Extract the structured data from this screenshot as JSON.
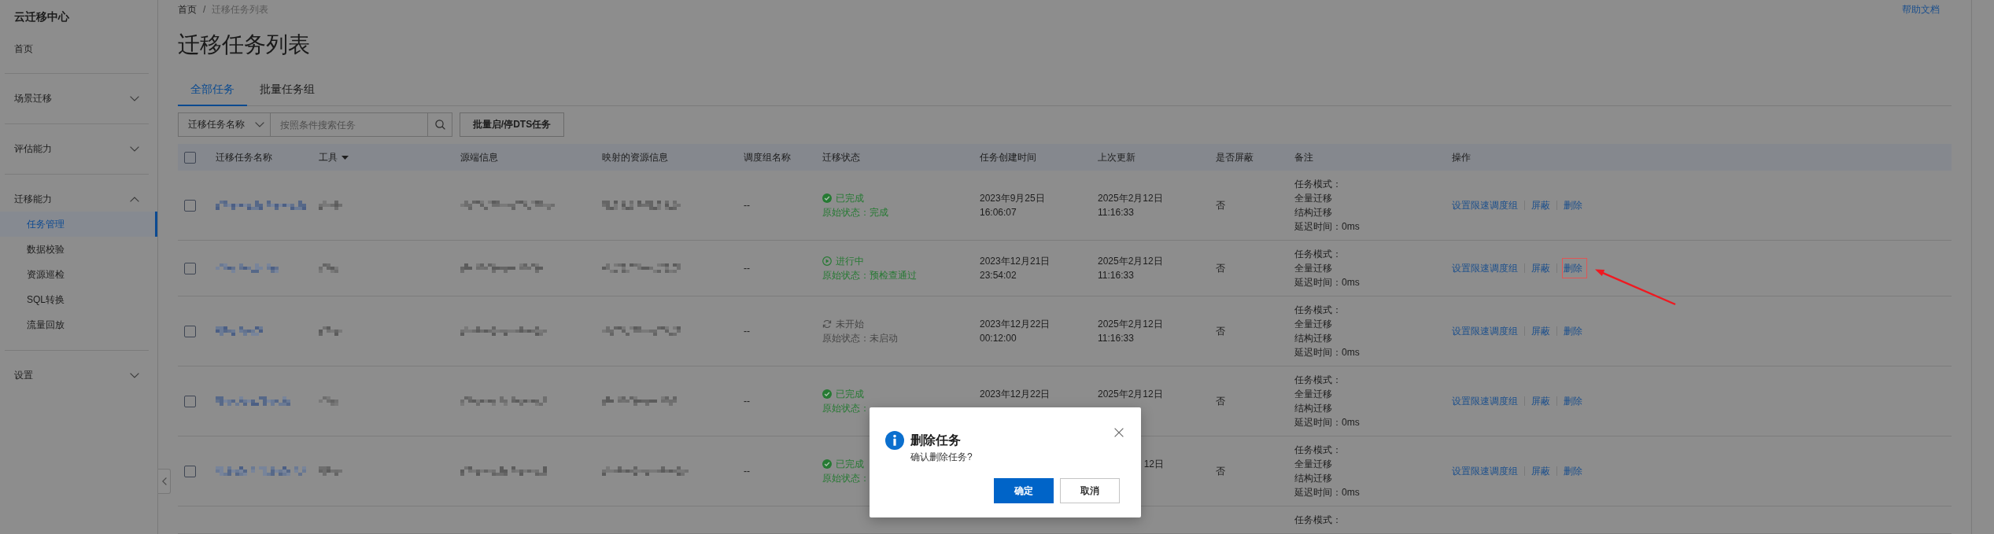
{
  "sidebar": {
    "title": "云迁移中心",
    "home": {
      "label": "首页",
      "selected": false
    },
    "groups": [
      {
        "label": "场景迁移",
        "expanded": false
      },
      {
        "label": "评估能力",
        "expanded": false
      },
      {
        "label": "迁移能力",
        "expanded": true,
        "children": [
          {
            "label": "任务管理",
            "selected": true
          },
          {
            "label": "数据校验",
            "selected": false
          },
          {
            "label": "资源巡检",
            "selected": false
          },
          {
            "label": "SQL转换",
            "selected": false
          },
          {
            "label": "流量回放",
            "selected": false
          }
        ]
      },
      {
        "label": "设置",
        "expanded": false
      }
    ]
  },
  "breadcrumb": {
    "items": [
      "首页",
      "迁移任务列表"
    ],
    "separator": "/"
  },
  "help_link": "帮助文档",
  "title": "迁移任务列表",
  "tabs": [
    {
      "label": "全部任务",
      "selected": true
    },
    {
      "label": "批量任务组",
      "selected": false
    }
  ],
  "toolbar": {
    "field_select": "迁移任务名称",
    "search": {
      "placeholder": "按照条件搜索任务"
    },
    "batch_button": "批量启/停DTS任务"
  },
  "table": {
    "select_all": {
      "checked": false
    },
    "columns": [
      {
        "label": "迁移任务名称"
      },
      {
        "label": "工具",
        "filter": true
      },
      {
        "label": "源端信息"
      },
      {
        "label": "映射的资源信息"
      },
      {
        "label": "调度组名称"
      },
      {
        "label": "迁移状态"
      },
      {
        "label": "任务创建时间"
      },
      {
        "label": "上次更新"
      },
      {
        "label": "是否屏蔽"
      },
      {
        "label": "备注"
      },
      {
        "label": "操作"
      }
    ],
    "rows": [
      {
        "checked": false,
        "pixelated": true,
        "dispatch_group": "--",
        "status": {
          "kind": "done",
          "label": "已完成",
          "original": "原始状态：完成"
        },
        "created": {
          "lines": [
            "2023年9月25日",
            "16:06:07"
          ]
        },
        "updated": {
          "lines": [
            "2025年2月12日",
            "11:16:33"
          ]
        },
        "masked": "否",
        "note": [
          "任务模式：",
          "全量迁移",
          "结构迁移",
          "延迟时间：0ms"
        ],
        "actions": [
          {
            "label": "设置限速调度组",
            "highlighted": false
          },
          {
            "label": "屏蔽",
            "highlighted": false
          },
          {
            "label": "删除",
            "highlighted": false
          }
        ]
      },
      {
        "checked": false,
        "pixelated": true,
        "dispatch_group": "--",
        "status": {
          "kind": "running",
          "label": "进行中",
          "original": "原始状态：预检查通过"
        },
        "created": {
          "lines": [
            "2023年12月21日",
            "23:54:02"
          ]
        },
        "updated": {
          "lines": [
            "2025年2月12日",
            "11:16:33"
          ]
        },
        "masked": "否",
        "note": [
          "任务模式：",
          "全量迁移",
          "延迟时间：0ms"
        ],
        "actions": [
          {
            "label": "设置限速调度组",
            "highlighted": false
          },
          {
            "label": "屏蔽",
            "highlighted": false
          },
          {
            "label": "删除",
            "highlighted": true
          }
        ]
      },
      {
        "checked": false,
        "pixelated": true,
        "dispatch_group": "--",
        "status": {
          "kind": "pending",
          "label": "未开始",
          "original": "原始状态：未启动"
        },
        "created": {
          "lines": [
            "2023年12月22日",
            "00:12:00"
          ]
        },
        "updated": {
          "lines": [
            "2025年2月12日",
            "11:16:33"
          ]
        },
        "masked": "否",
        "note": [
          "任务模式：",
          "全量迁移",
          "结构迁移",
          "延迟时间：0ms"
        ],
        "actions": [
          {
            "label": "设置限速调度组",
            "highlighted": false
          },
          {
            "label": "屏蔽",
            "highlighted": false
          },
          {
            "label": "删除",
            "highlighted": false
          }
        ]
      },
      {
        "checked": false,
        "pixelated": true,
        "dispatch_group": "--",
        "status": {
          "kind": "done",
          "label": "已完成",
          "original": "原始状态："
        },
        "created": {
          "lines": [
            "2023年12月22日"
          ]
        },
        "updated": {
          "lines": [
            "2025年2月12日"
          ]
        },
        "masked": "否",
        "note": [
          "任务模式：",
          "全量迁移",
          "结构迁移",
          "延迟时间：0ms"
        ],
        "actions": [
          {
            "label": "设置限速调度组",
            "highlighted": false
          },
          {
            "label": "屏蔽",
            "highlighted": false
          },
          {
            "label": "删除",
            "highlighted": false
          }
        ]
      },
      {
        "checked": false,
        "pixelated": true,
        "dispatch_group": "--",
        "status": {
          "kind": "done",
          "label": "已完成",
          "original": "原始状态："
        },
        "updated": {
          "lines": [
            "12日"
          ],
          "covered_left": true
        },
        "masked": "否",
        "note": [
          "任务模式：",
          "全量迁移",
          "结构迁移",
          "延迟时间：0ms"
        ],
        "actions": [
          {
            "label": "设置限速调度组",
            "highlighted": false
          },
          {
            "label": "屏蔽",
            "highlighted": false
          },
          {
            "label": "删除",
            "highlighted": false
          }
        ]
      },
      {
        "note": [
          "任务模式："
        ]
      }
    ]
  },
  "dialog": {
    "kind": "info",
    "title": "删除任务",
    "message": "确认删除任务?",
    "closable": true,
    "buttons": [
      {
        "label": "确定",
        "kind": "primary"
      },
      {
        "label": "取消",
        "kind": "secondary"
      }
    ]
  }
}
